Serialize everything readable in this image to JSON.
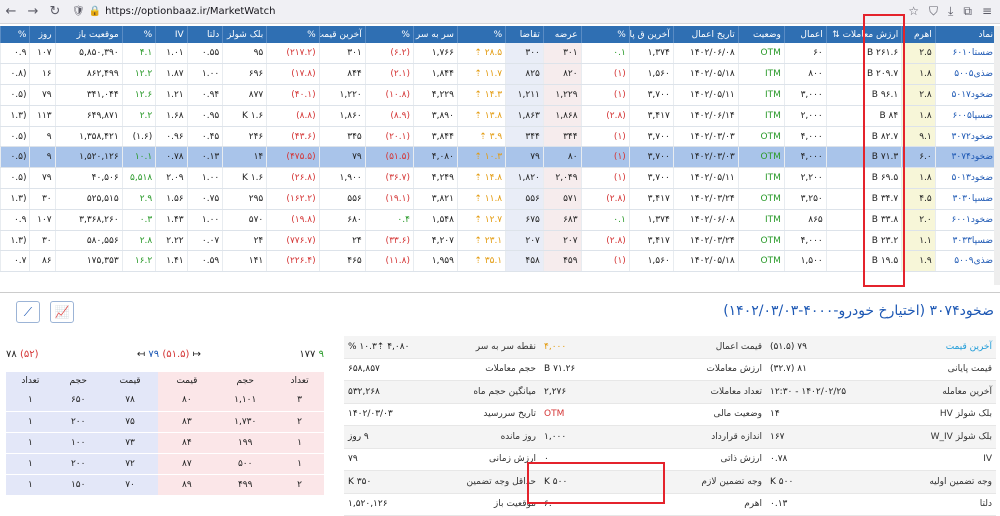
{
  "browser": {
    "url_scheme": "https://",
    "url_host": "optionbaaz.ir/MarketWatch"
  },
  "grid": {
    "headers": [
      "نماد",
      "اهرم",
      "ارزش معاملات ⇅",
      "اعمال",
      "وضعیت",
      "تاریخ اعمال",
      "آخرین ق پایه",
      "%",
      "عرضه",
      "تقاضا",
      "%",
      "سر به سر",
      "%",
      "آخرین قیمت",
      "%",
      "بلک شولز",
      "دلتا",
      "IV",
      "%",
      "موقعیت باز",
      "روز",
      "%"
    ],
    "rows": [
      [
        "ضستا۶۰۱۰",
        "۲.۵",
        "۲۶۱.۶ B",
        "۶۰",
        "OTM",
        "۱۴۰۲/۰۶/۰۸",
        "۱,۳۷۴",
        "۰.۱",
        "۳۰۱",
        "۳۰۰",
        "۲۸.۵ ⇡",
        "۱,۷۶۶",
        "(۶.۲)",
        "۳۰۱",
        "(۲۱۷.۲)",
        "۹۵",
        "۰.۵۵",
        "۱.۰۱",
        "۴.۱",
        "۵,۸۵۰,۳۹۰",
        "۱۰۷",
        "۰.۹"
      ],
      [
        "ضذی۵۰۰۵",
        "۱.۸",
        "۲۰۹.۷ B",
        "۸۰۰",
        "ITM",
        "۱۴۰۲/۰۵/۱۸",
        "۱,۵۶۰",
        "(۱)",
        "۸۲۰",
        "۸۲۵",
        "۱۱.۷ ⇡",
        "۱,۸۴۴",
        "(۲.۱)",
        "۸۴۴",
        "(۱۷.۸)",
        "۶۹۶",
        "۱.۰۰",
        "۱.۸۷",
        "۱۲.۲",
        "۸۶۲,۴۹۹",
        "۱۶",
        "(۰.۸"
      ],
      [
        "ضخود۵۰۱۷",
        "۲.۸",
        "۹۶.۱ B",
        "۳,۰۰۰",
        "ITM",
        "۱۴۰۲/۰۵/۱۱",
        "۳,۷۰۰",
        "(۱)",
        "۱,۲۲۹",
        "۱,۲۱۱",
        "۱۴.۳ ⇡",
        "۴,۲۲۹",
        "(۱۰.۸)",
        "۱,۲۲۰",
        "(۴۰.۱)",
        "۸۷۷",
        "۰.۹۴",
        "۱.۲۱",
        "۱۲.۶",
        "۳۴۱,۰۴۴",
        "۷۹",
        "(۰.۵"
      ],
      [
        "ضسپا۶۰۰۵",
        "۱.۸",
        "۸۴ B",
        "۲,۰۰۰",
        "ITM",
        "۱۴۰۲/۰۶/۱۴",
        "۳,۴۱۷",
        "(۲.۸)",
        "۱,۸۶۸",
        "۱,۸۶۳",
        "۱۳.۸ ⇡",
        "۳,۸۹۰",
        "(۸.۹)",
        "۱,۸۶۰",
        "(۸.۸)",
        "۱.۶ K",
        "۰.۹۵",
        "۱.۶۸",
        "۲.۲",
        "۶۴۹,۸۷۱",
        "۱۱۳",
        "(۱.۳"
      ],
      [
        "ضخود۳۰۷۲",
        "۹.۱",
        "۸۲.۷ B",
        "۴,۰۰۰",
        "OTM",
        "۱۴۰۲/۰۳/۰۳",
        "۳,۷۰۰",
        "(۱)",
        "۳۴۴",
        "۳۴۴",
        "۳.۹ ⇡",
        "۳,۸۴۴",
        "(۲۰.۱)",
        "۳۴۵",
        "(۴۳.۶)",
        "۲۴۶",
        "۰.۴۵",
        "۰.۹۶",
        "(۱.۶)",
        "۱,۳۵۸,۴۲۱",
        "۹",
        "(۰.۵"
      ],
      [
        "ضخود۳۰۷۴",
        "۶.۰",
        "۷۱.۳ B",
        "۴,۰۰۰",
        "OTM",
        "۱۴۰۲/۰۳/۰۳",
        "۳,۷۰۰",
        "(۱)",
        "۸۰",
        "۷۹",
        "۱۰.۳ ⇡",
        "۴,۰۸۰",
        "(۵۱.۵)",
        "۷۹",
        "(۴۷۵.۵)",
        "۱۴",
        "۰.۱۳",
        "۰.۷۸",
        "۱۰.۱",
        "۱,۵۲۰,۱۲۶",
        "۹",
        "(۰.۵"
      ],
      [
        "ضخود۵۰۱۳",
        "۱.۸",
        "۶۹.۵ B",
        "۲,۲۰۰",
        "ITM",
        "۱۴۰۲/۰۵/۱۱",
        "۳,۷۰۰",
        "(۱)",
        "۲,۰۴۹",
        "۱,۸۲۰",
        "۱۴.۸ ⇡",
        "۴,۲۴۹",
        "(۳۶.۷)",
        "۱,۹۰۰",
        "(۲۶.۸)",
        "۱.۶ K",
        "۱.۰۰",
        "۲.۰۹",
        "۵,۵۱۸",
        "۴۰,۵۰۶",
        "۷۹",
        "(۰.۵"
      ],
      [
        "ضسپا۳۰۳۰",
        "۴.۵",
        "۳۴.۷ B",
        "۳,۲۵۰",
        "OTM",
        "۱۴۰۲/۰۳/۲۴",
        "۳,۴۱۷",
        "(۲.۸)",
        "۵۷۱",
        "۵۵۶",
        "۱۱.۸ ⇡",
        "۳,۸۲۱",
        "(۱۹.۱)",
        "۵۵۶",
        "(۱۶۲.۲)",
        "۲۹۵",
        "۰.۷۵",
        "۱.۵۶",
        "۲.۹",
        "۵۲۵,۵۱۵",
        "۳۰",
        "(۱.۳"
      ],
      [
        "ضخود۶۰۰۱",
        "۲.۰",
        "۳۳.۸ B",
        "۸۶۵",
        "ITM",
        "۱۴۰۲/۰۶/۰۸",
        "۱,۳۷۴",
        "۰.۱",
        "۶۸۳",
        "۶۷۵",
        "۱۲.۷ ⇡",
        "۱,۵۴۸",
        "۰.۴",
        "۶۸۰",
        "(۱۹.۸)",
        "۵۷۰",
        "۱.۰۰",
        "۱.۴۳",
        "۰.۳",
        "۳,۳۶۸,۲۶۰",
        "۱۰۷",
        "۰.۹"
      ],
      [
        "ضسپا۳۰۳۳",
        "۱.۱",
        "۲۳.۲ B",
        "۴,۰۰۰",
        "OTM",
        "۱۴۰۲/۰۳/۲۴",
        "۳,۴۱۷",
        "(۲.۸)",
        "۲۰۷",
        "۲۰۷",
        "۲۳.۱ ⇡",
        "۴,۲۰۷",
        "(۳۳.۶)",
        "۲۴",
        "(۷۷۶.۷)",
        "۲۴",
        "۰.۰۷",
        "۲.۲۲",
        "۲.۸",
        "۵۸۰,۵۵۶",
        "۳۰",
        "(۱.۳"
      ],
      [
        "ضذی۵۰۰۹",
        "۱.۹",
        "۱۹.۵ B",
        "۱,۵۰۰",
        "OTM",
        "۱۴۰۲/۰۵/۱۸",
        "۱,۵۶۰",
        "(۱)",
        "۴۵۹",
        "۴۵۸",
        "۳۵.۱ ⇡",
        "۱,۹۵۹",
        "(۱۱.۸)",
        "۴۶۵",
        "(۲۲۶.۴)",
        "۱۴۱",
        "۰.۵۹",
        "۱.۴۱",
        "۱۶.۲",
        "۱۷۵,۳۵۳",
        "۸۶",
        "۰.۷"
      ]
    ],
    "selected_row": 5
  },
  "panel": {
    "title": "ضخود۳۰۷۴ (اختیارخ خودرو-۴۰۰۰-۱۴۰۲/۰۳/۰۳)",
    "orderbook_head": {
      "left_value": "۷۸",
      "left_pct": "(۵۲)",
      "mid_value": "۷۹",
      "mid_pct": "(۵۱.۵)",
      "right_count": "۱۷۷",
      "right_num": "۹"
    },
    "orderbook_headers": [
      "تعداد",
      "حجم",
      "قیمت",
      "قیمت",
      "حجم",
      "تعداد"
    ],
    "orderbook_rows": [
      [
        "۱",
        "۶۵۰",
        "۷۸",
        "۸۰",
        "۱,۱۰۱",
        "۳"
      ],
      [
        "۱",
        "۲۰۰",
        "۷۵",
        "۸۳",
        "۱,۷۳۰",
        "۲"
      ],
      [
        "۱",
        "۱۰۰",
        "۷۳",
        "۸۴",
        "۱۹۹",
        "۱"
      ],
      [
        "۱",
        "۲۰۰",
        "۷۲",
        "۸۷",
        "۵۰۰",
        "۱"
      ],
      [
        "۱",
        "۱۵۰",
        "۷۰",
        "۸۹",
        "۴۹۹",
        "۲"
      ]
    ],
    "info_rows": [
      [
        [
          "آخرین قیمت",
          "۷۹ (۵۱.۵)"
        ],
        [
          "قیمت اعمال",
          "۴,۰۰۰"
        ],
        [
          "نقطه سر به سر",
          "۴,۰۸۰  ⇡۱۰.۳ %"
        ]
      ],
      [
        [
          "قیمت پایانی",
          "۸۱ (۳۲.۷)"
        ],
        [
          "ارزش معاملات",
          "۷۱.۲۶ B"
        ],
        [
          "حجم معاملات",
          "۶۵۸,۸۵۷"
        ]
      ],
      [
        [
          "آخرین معامله",
          "۱۴۰۲/۰۲/۲۵ - ۱۲:۳۰"
        ],
        [
          "تعداد معاملات",
          "۲,۲۷۶"
        ],
        [
          "میانگین حجم ماه",
          "۵۳۲,۲۶۸"
        ]
      ],
      [
        [
          "بلک شولز HV",
          "۱۴"
        ],
        [
          "وضعیت مالی",
          "OTM"
        ],
        [
          "تاریخ سررسید",
          "۱۴۰۲/۰۳/۰۳"
        ]
      ],
      [
        [
          "بلک شولز W_IV",
          "۱۶۷"
        ],
        [
          "اندازه قرارداد",
          "۱,۰۰۰"
        ],
        [
          "روز مانده",
          "۹ روز"
        ]
      ],
      [
        [
          "IV",
          "۰.۷۸"
        ],
        [
          "ارزش ذاتی",
          "۰"
        ],
        [
          "ارزش زمانی",
          "۷۹"
        ]
      ],
      [
        [
          "وجه تضمین اولیه",
          "۵۰۰ K"
        ],
        [
          "وجه تضمین لازم",
          "۵۰۰ K"
        ],
        [
          "حداقل وجه تضمین",
          "۳۵۰ K"
        ]
      ],
      [
        [
          "دلتا",
          "۰.۱۳"
        ],
        [
          "اهرم",
          "۶.۰"
        ],
        [
          "موقعیت باز",
          "۱,۵۲۰,۱۲۶"
        ]
      ]
    ]
  },
  "colors": {
    "header_blue": "#2f6fb3",
    "highlight": "#e4232c"
  }
}
